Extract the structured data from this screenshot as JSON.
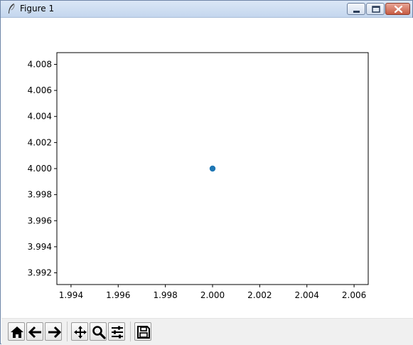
{
  "window": {
    "title": "Figure 1"
  },
  "titlebar_buttons": {
    "minimize": "minimize-icon",
    "maximize": "maximize-icon",
    "close": "close-icon"
  },
  "toolbar": {
    "buttons": [
      {
        "name": "home-button",
        "icon": "home-icon"
      },
      {
        "name": "back-button",
        "icon": "arrow-left-icon"
      },
      {
        "name": "forward-button",
        "icon": "arrow-right-icon"
      },
      {
        "name": "pan-button",
        "icon": "move-icon"
      },
      {
        "name": "zoom-button",
        "icon": "magnifier-icon"
      },
      {
        "name": "subplots-button",
        "icon": "sliders-icon"
      },
      {
        "name": "save-button",
        "icon": "floppy-icon"
      }
    ]
  },
  "chart_data": {
    "type": "scatter",
    "title": "",
    "xlabel": "",
    "ylabel": "",
    "xlim": [
      1.9934,
      2.0066
    ],
    "ylim": [
      3.9911,
      4.0089
    ],
    "xticks": [
      "1.994",
      "1.996",
      "1.998",
      "2.000",
      "2.002",
      "2.004",
      "2.006"
    ],
    "yticks": [
      "3.992",
      "3.994",
      "3.996",
      "3.998",
      "4.000",
      "4.002",
      "4.004",
      "4.006",
      "4.008"
    ],
    "series": [
      {
        "points": [
          {
            "x": 2.0,
            "y": 4.0
          }
        ]
      }
    ],
    "colors": {
      "marker": "#1f77b4"
    },
    "grid": false
  }
}
